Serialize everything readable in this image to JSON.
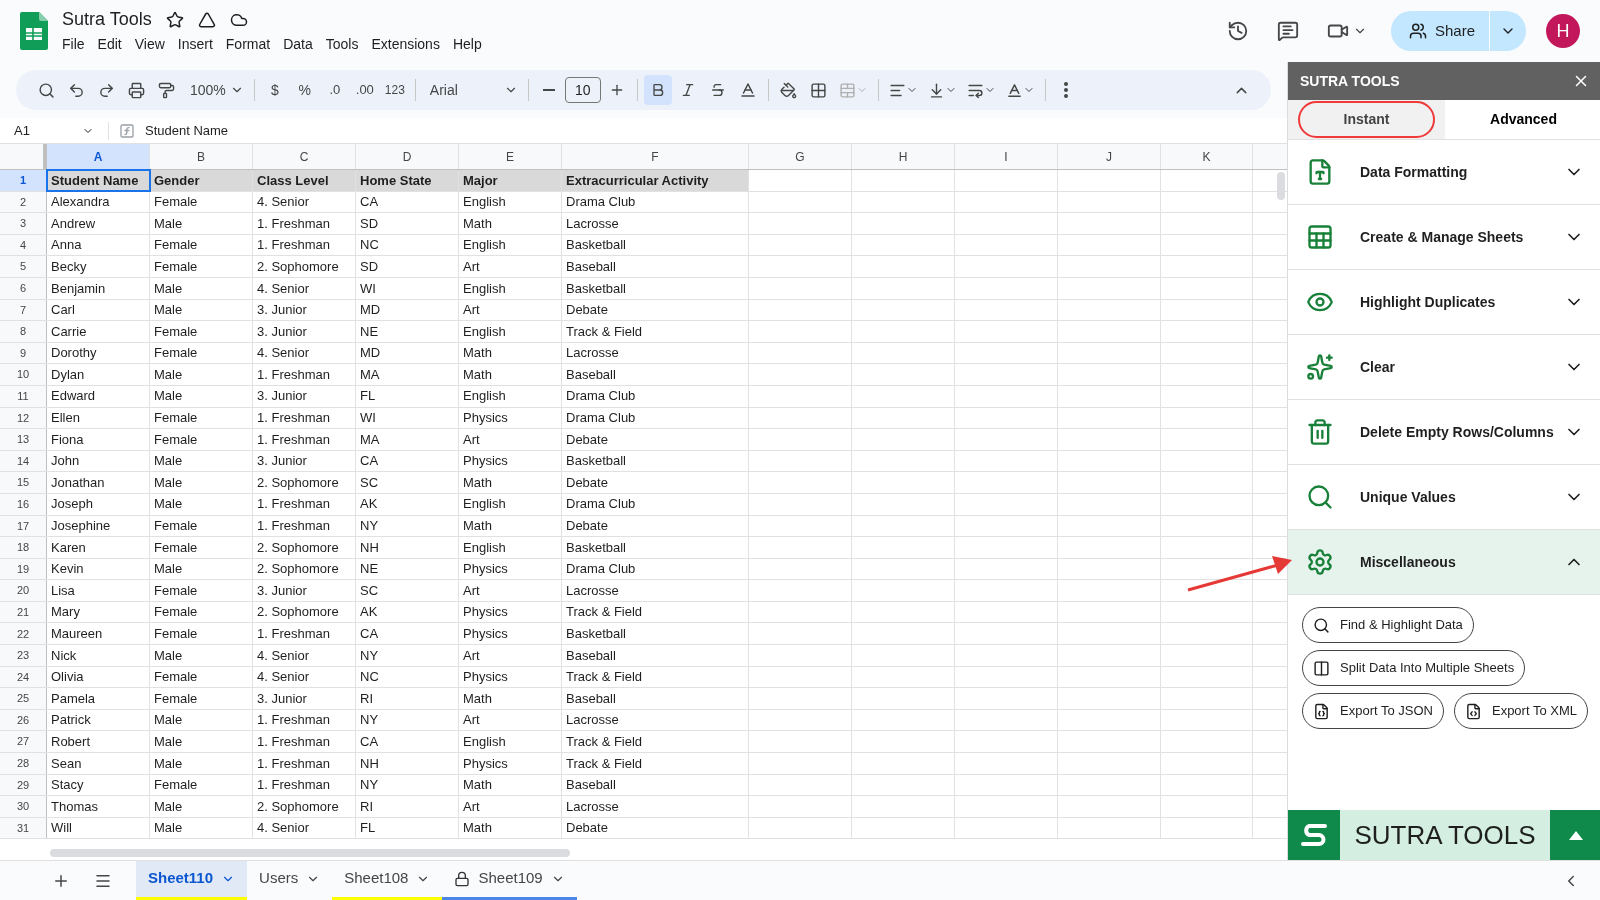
{
  "document": {
    "title": "Sutra Tools",
    "menus": [
      "File",
      "Edit",
      "View",
      "Insert",
      "Format",
      "Data",
      "Tools",
      "Extensions",
      "Help"
    ]
  },
  "share": {
    "label": "Share"
  },
  "account": {
    "initial": "H"
  },
  "toolbar": {
    "zoom": "100%",
    "currency": "$",
    "percent": "%",
    "decrease_decimals": ".0",
    "increase_decimals": ".00",
    "number_format": "123",
    "font": "Arial",
    "font_size": "10",
    "bold": true
  },
  "formula_bar": {
    "cell": "A1",
    "content": "Student Name"
  },
  "sheet": {
    "columns": [
      {
        "label": "A",
        "selected": true
      },
      {
        "label": "B",
        "selected": false
      },
      {
        "label": "C",
        "selected": false
      },
      {
        "label": "D",
        "selected": false
      },
      {
        "label": "E",
        "selected": false
      },
      {
        "label": "F",
        "selected": false
      },
      {
        "label": "G",
        "selected": false
      },
      {
        "label": "H",
        "selected": false
      },
      {
        "label": "I",
        "selected": false
      },
      {
        "label": "J",
        "selected": false
      },
      {
        "label": "K",
        "selected": false
      }
    ],
    "row_numbers": [
      {
        "label": "1",
        "selected": true
      },
      {
        "label": "2",
        "selected": false
      },
      {
        "label": "3",
        "selected": false
      },
      {
        "label": "4",
        "selected": false
      },
      {
        "label": "5",
        "selected": false
      },
      {
        "label": "6",
        "selected": false
      },
      {
        "label": "7",
        "selected": false
      },
      {
        "label": "8",
        "selected": false
      },
      {
        "label": "9",
        "selected": false
      },
      {
        "label": "10",
        "selected": false
      },
      {
        "label": "11",
        "selected": false
      },
      {
        "label": "12",
        "selected": false
      },
      {
        "label": "13",
        "selected": false
      },
      {
        "label": "14",
        "selected": false
      },
      {
        "label": "15",
        "selected": false
      },
      {
        "label": "16",
        "selected": false
      },
      {
        "label": "17",
        "selected": false
      },
      {
        "label": "18",
        "selected": false
      },
      {
        "label": "19",
        "selected": false
      },
      {
        "label": "20",
        "selected": false
      },
      {
        "label": "21",
        "selected": false
      },
      {
        "label": "22",
        "selected": false
      },
      {
        "label": "23",
        "selected": false
      },
      {
        "label": "24",
        "selected": false
      },
      {
        "label": "25",
        "selected": false
      },
      {
        "label": "26",
        "selected": false
      },
      {
        "label": "27",
        "selected": false
      },
      {
        "label": "28",
        "selected": false
      },
      {
        "label": "29",
        "selected": false
      },
      {
        "label": "30",
        "selected": false
      },
      {
        "label": "31",
        "selected": false
      }
    ],
    "rows": [
      [
        "Student Name",
        "Gender",
        "Class Level",
        "Home State",
        "Major",
        "Extracurricular Activity"
      ],
      [
        "Alexandra",
        "Female",
        "4. Senior",
        "CA",
        "English",
        "Drama Club"
      ],
      [
        "Andrew",
        "Male",
        "1. Freshman",
        "SD",
        "Math",
        "Lacrosse"
      ],
      [
        "Anna",
        "Female",
        "1. Freshman",
        "NC",
        "English",
        "Basketball"
      ],
      [
        "Becky",
        "Female",
        "2. Sophomore",
        "SD",
        "Art",
        "Baseball"
      ],
      [
        "Benjamin",
        "Male",
        "4. Senior",
        "WI",
        "English",
        "Basketball"
      ],
      [
        "Carl",
        "Male",
        "3. Junior",
        "MD",
        "Art",
        "Debate"
      ],
      [
        "Carrie",
        "Female",
        "3. Junior",
        "NE",
        "English",
        "Track & Field"
      ],
      [
        "Dorothy",
        "Female",
        "4. Senior",
        "MD",
        "Math",
        "Lacrosse"
      ],
      [
        "Dylan",
        "Male",
        "1. Freshman",
        "MA",
        "Math",
        "Baseball"
      ],
      [
        "Edward",
        "Male",
        "3. Junior",
        "FL",
        "English",
        "Drama Club"
      ],
      [
        "Ellen",
        "Female",
        "1. Freshman",
        "WI",
        "Physics",
        "Drama Club"
      ],
      [
        "Fiona",
        "Female",
        "1. Freshman",
        "MA",
        "Art",
        "Debate"
      ],
      [
        "John",
        "Male",
        "3. Junior",
        "CA",
        "Physics",
        "Basketball"
      ],
      [
        "Jonathan",
        "Male",
        "2. Sophomore",
        "SC",
        "Math",
        "Debate"
      ],
      [
        "Joseph",
        "Male",
        "1. Freshman",
        "AK",
        "English",
        "Drama Club"
      ],
      [
        "Josephine",
        "Female",
        "1. Freshman",
        "NY",
        "Math",
        "Debate"
      ],
      [
        "Karen",
        "Female",
        "2. Sophomore",
        "NH",
        "English",
        "Basketball"
      ],
      [
        "Kevin",
        "Male",
        "2. Sophomore",
        "NE",
        "Physics",
        "Drama Club"
      ],
      [
        "Lisa",
        "Female",
        "3. Junior",
        "SC",
        "Art",
        "Lacrosse"
      ],
      [
        "Mary",
        "Female",
        "2. Sophomore",
        "AK",
        "Physics",
        "Track & Field"
      ],
      [
        "Maureen",
        "Female",
        "1. Freshman",
        "CA",
        "Physics",
        "Basketball"
      ],
      [
        "Nick",
        "Male",
        "4. Senior",
        "NY",
        "Art",
        "Baseball"
      ],
      [
        "Olivia",
        "Female",
        "4. Senior",
        "NC",
        "Physics",
        "Track & Field"
      ],
      [
        "Pamela",
        "Female",
        "3. Junior",
        "RI",
        "Math",
        "Baseball"
      ],
      [
        "Patrick",
        "Male",
        "1. Freshman",
        "NY",
        "Art",
        "Lacrosse"
      ],
      [
        "Robert",
        "Male",
        "1. Freshman",
        "CA",
        "English",
        "Track & Field"
      ],
      [
        "Sean",
        "Male",
        "1. Freshman",
        "NH",
        "Physics",
        "Track & Field"
      ],
      [
        "Stacy",
        "Female",
        "1. Freshman",
        "NY",
        "Math",
        "Baseball"
      ],
      [
        "Thomas",
        "Male",
        "2. Sophomore",
        "RI",
        "Art",
        "Lacrosse"
      ],
      [
        "Will",
        "Male",
        "4. Senior",
        "FL",
        "Math",
        "Debate"
      ]
    ]
  },
  "sheet_tabs": [
    {
      "label": "Sheet110",
      "selected": true,
      "locked": false,
      "color": "#ffff00"
    },
    {
      "label": "Users",
      "selected": false,
      "locked": false
    },
    {
      "label": "Sheet108",
      "selected": false,
      "locked": false,
      "color": "#ffff00"
    },
    {
      "label": "Sheet109",
      "selected": false,
      "locked": true,
      "color": "#4a86e8"
    }
  ],
  "sidebar": {
    "title": "SUTRA TOOLS",
    "tabs": [
      {
        "label": "Instant",
        "selected": true
      },
      {
        "label": "Advanced",
        "selected": false
      }
    ],
    "sections": [
      {
        "label": "Data Formatting",
        "expanded": false
      },
      {
        "label": "Create & Manage Sheets",
        "expanded": false
      },
      {
        "label": "Highlight Duplicates",
        "expanded": false
      },
      {
        "label": "Clear",
        "expanded": false
      },
      {
        "label": "Delete Empty Rows/Columns",
        "expanded": false
      },
      {
        "label": "Unique Values",
        "expanded": false
      },
      {
        "label": "Miscellaneous",
        "expanded": true
      }
    ],
    "actions": [
      [
        "Find & Highlight Data"
      ],
      [
        "Split Data Into Multiple Sheets"
      ],
      [
        "Export To JSON",
        "Export To XML"
      ]
    ],
    "brand": "SUTRA TOOLS"
  }
}
